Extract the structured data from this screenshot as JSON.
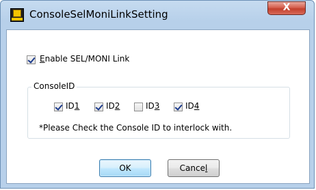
{
  "window": {
    "title": "ConsoleSelMoniLinkSetting",
    "close_label": "X"
  },
  "enable_link": {
    "prefix": "",
    "mnemonic": "E",
    "rest": "nable SEL/MONI Link",
    "checked": true
  },
  "console_id": {
    "group_label": "ConsoleID",
    "items": [
      {
        "prefix": "ID",
        "mnemonic": "1",
        "checked": true
      },
      {
        "prefix": "ID",
        "mnemonic": "2",
        "checked": true
      },
      {
        "prefix": "ID",
        "mnemonic": "3",
        "checked": false
      },
      {
        "prefix": "ID",
        "mnemonic": "4",
        "checked": true
      }
    ],
    "note": "*Please Check the Console ID to interlock with."
  },
  "buttons": {
    "ok": "OK",
    "cancel_prefix": "Cance",
    "cancel_mnemonic": "l"
  },
  "colors": {
    "title_bar": "#b7d0ea",
    "close_button": "#c2402d",
    "default_button": "#bee6fd"
  }
}
